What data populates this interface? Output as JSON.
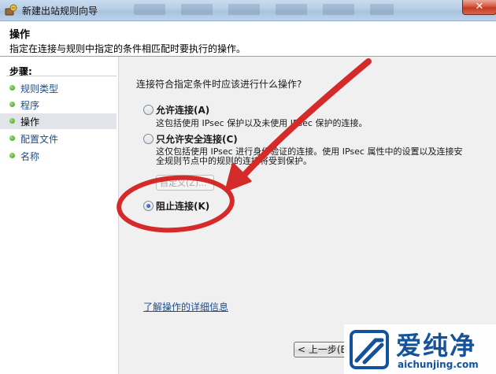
{
  "window": {
    "title": "新建出站规则向导",
    "close_label": "✕"
  },
  "header": {
    "title": "操作",
    "description": "指定在连接与规则中指定的条件相匹配时要执行的操作。"
  },
  "steps": {
    "title": "步骤:",
    "items": [
      {
        "label": "规则类型",
        "active": false
      },
      {
        "label": "程序",
        "active": false
      },
      {
        "label": "操作",
        "active": true
      },
      {
        "label": "配置文件",
        "active": false
      },
      {
        "label": "名称",
        "active": false
      }
    ]
  },
  "main": {
    "question": "连接符合指定条件时应该进行什么操作?",
    "options": [
      {
        "label": "允许连接(A)",
        "desc_lines": [
          "这包括使用 IPsec 保护以及未使用 IPsec 保护的连接。"
        ],
        "selected": false
      },
      {
        "label": "只允许安全连接(C)",
        "desc_lines": [
          "这仅包括使用 IPsec 进行身份验证的连接。使用 IPsec 属性中的设置以及连接安",
          "全规则节点中的规则的连接将受到保护。"
        ],
        "selected": false
      },
      {
        "label": "阻止连接(K)",
        "desc_lines": [],
        "selected": true
      }
    ],
    "customize_label": "自定义(Z)...",
    "learn_more_link": "了解操作的详细信息",
    "back_button": "< 上一步(B)"
  },
  "annotation": {
    "color": "#d42a2a"
  },
  "watermark": {
    "brand_text": "爱纯净",
    "url": "aichunjing.com",
    "color": "#13539c"
  }
}
